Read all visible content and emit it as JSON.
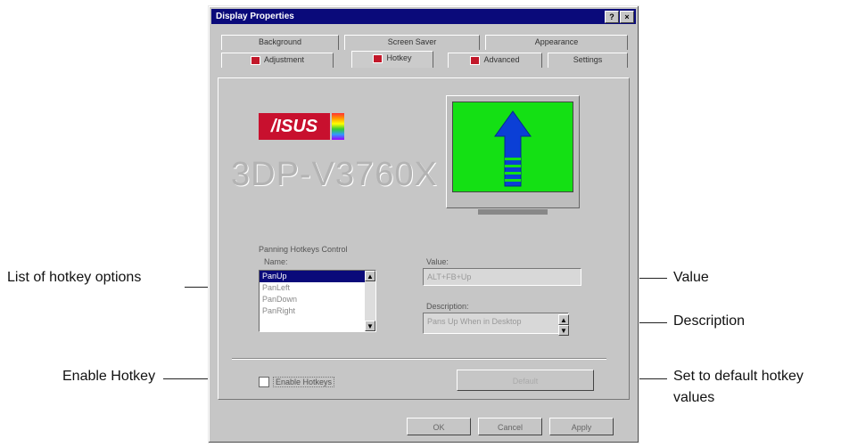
{
  "window": {
    "title": "Display Properties",
    "help_btn": "?",
    "close_btn": "×"
  },
  "tabs": {
    "row1": [
      "Background",
      "Screen Saver",
      "Appearance"
    ],
    "row2": [
      "Adjustment",
      "Hotkey",
      "Advanced",
      "Settings"
    ],
    "active": "Hotkey"
  },
  "panel": {
    "logo_text": "/ISUS",
    "model": "3DP-V3760X",
    "group_label": "Panning Hotkeys Control",
    "name_label": "Name:",
    "items": [
      "PanUp",
      "PanLeft",
      "PanDown",
      "PanRight"
    ],
    "value_label": "Value:",
    "value_text": "ALT+FB+Up",
    "description_label": "Description:",
    "description_text": "Pans Up When in Desktop",
    "enable_label": "Enable Hotkeys",
    "default_button": "Default"
  },
  "buttons": {
    "ok": "OK",
    "cancel": "Cancel",
    "apply": "Apply"
  },
  "callouts": {
    "list": "List of hotkey options",
    "enable": "Enable Hotkey",
    "value": "Value",
    "description": "Description",
    "default_line1": "Set to default hotkey",
    "default_line2": "values"
  }
}
